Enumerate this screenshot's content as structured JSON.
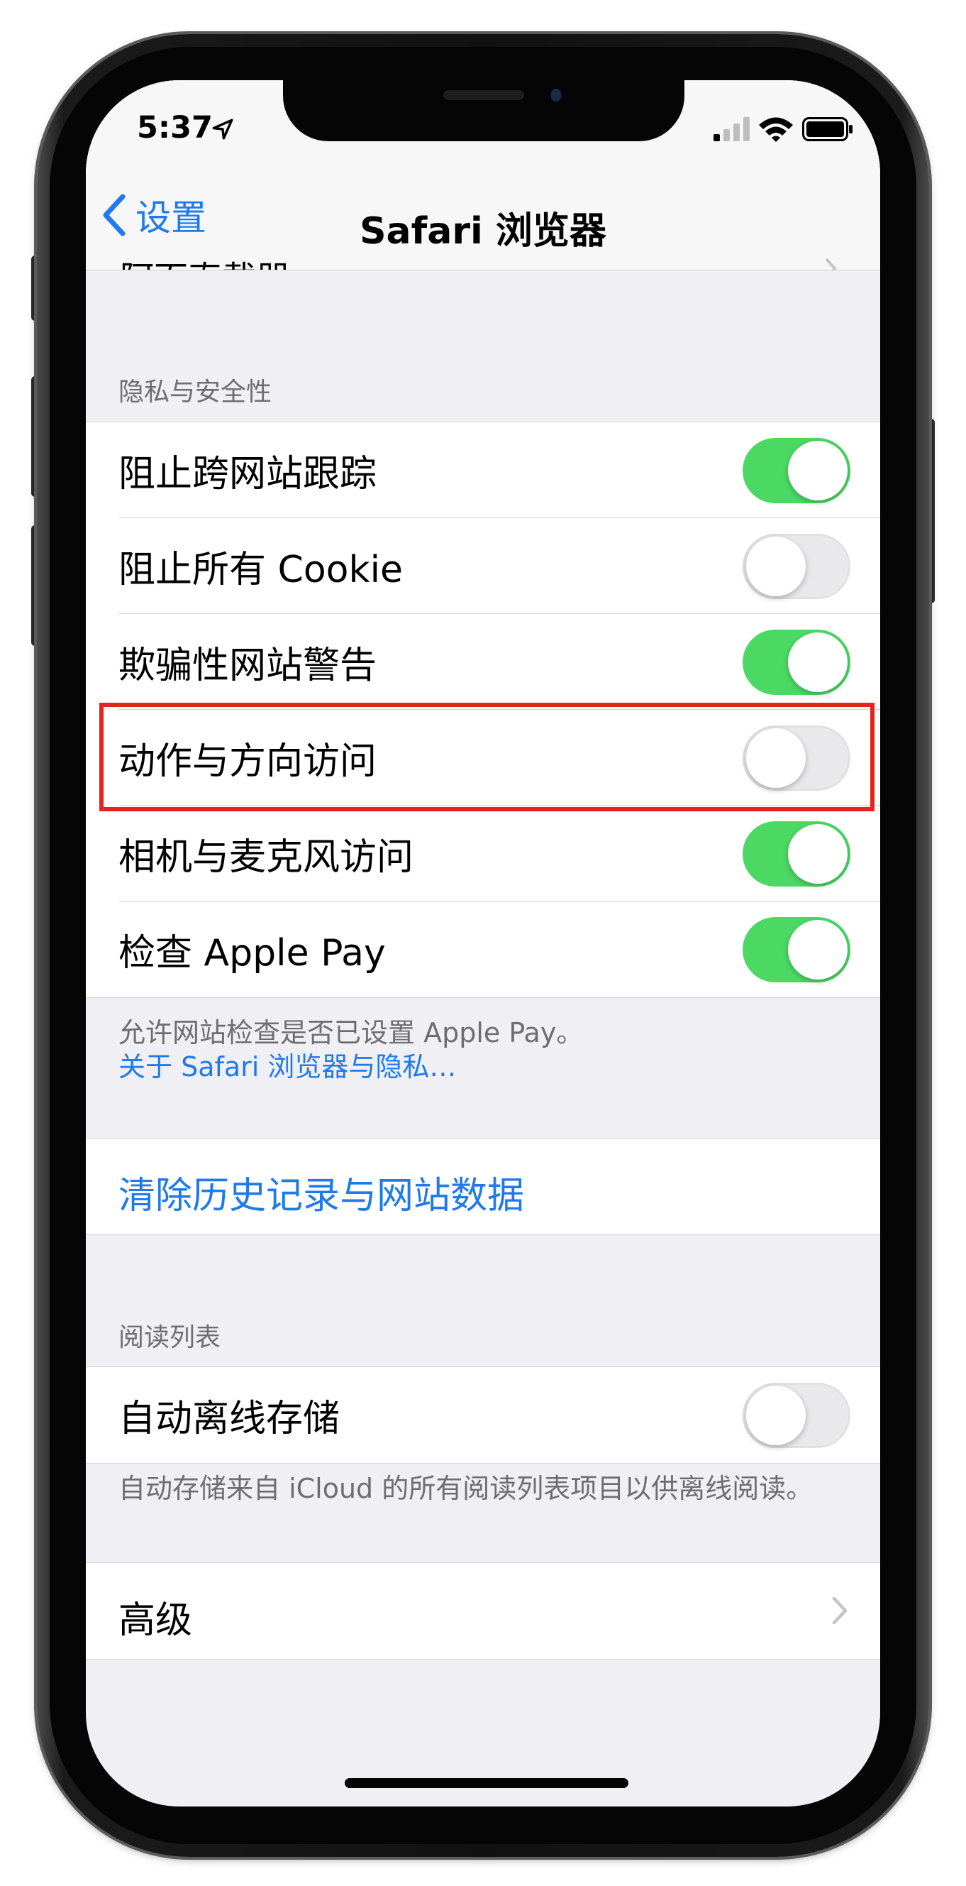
{
  "status_bar": {
    "time": "5:37"
  },
  "nav": {
    "back_label": "设置",
    "title": "Safari 浏览器",
    "partial_row": "阿面直载器"
  },
  "privacy": {
    "header": "隐私与安全性",
    "rows": [
      {
        "label": "阻止跨网站跟踪",
        "on": true
      },
      {
        "label": "阻止所有 Cookie",
        "on": false
      },
      {
        "label": "欺骗性网站警告",
        "on": true
      },
      {
        "label": "动作与方向访问",
        "on": false
      },
      {
        "label": "相机与麦克风访问",
        "on": true
      },
      {
        "label": "检查 Apple Pay",
        "on": true
      }
    ],
    "footer_text": "允许网站检查是否已设置 Apple Pay。",
    "footer_link": "关于 Safari 浏览器与隐私…"
  },
  "clear_history": {
    "label": "清除历史记录与网站数据"
  },
  "reading_list": {
    "header": "阅读列表",
    "row_label": "自动离线存储",
    "row_on": false,
    "footer_text": "自动存储来自 iCloud 的所有阅读列表项目以供离线阅读。"
  },
  "advanced": {
    "label": "高级"
  },
  "colors": {
    "accent": "#1f7aed",
    "toggle_on": "#4bd964",
    "highlight": "#e3251c",
    "background": "#efeff4"
  }
}
